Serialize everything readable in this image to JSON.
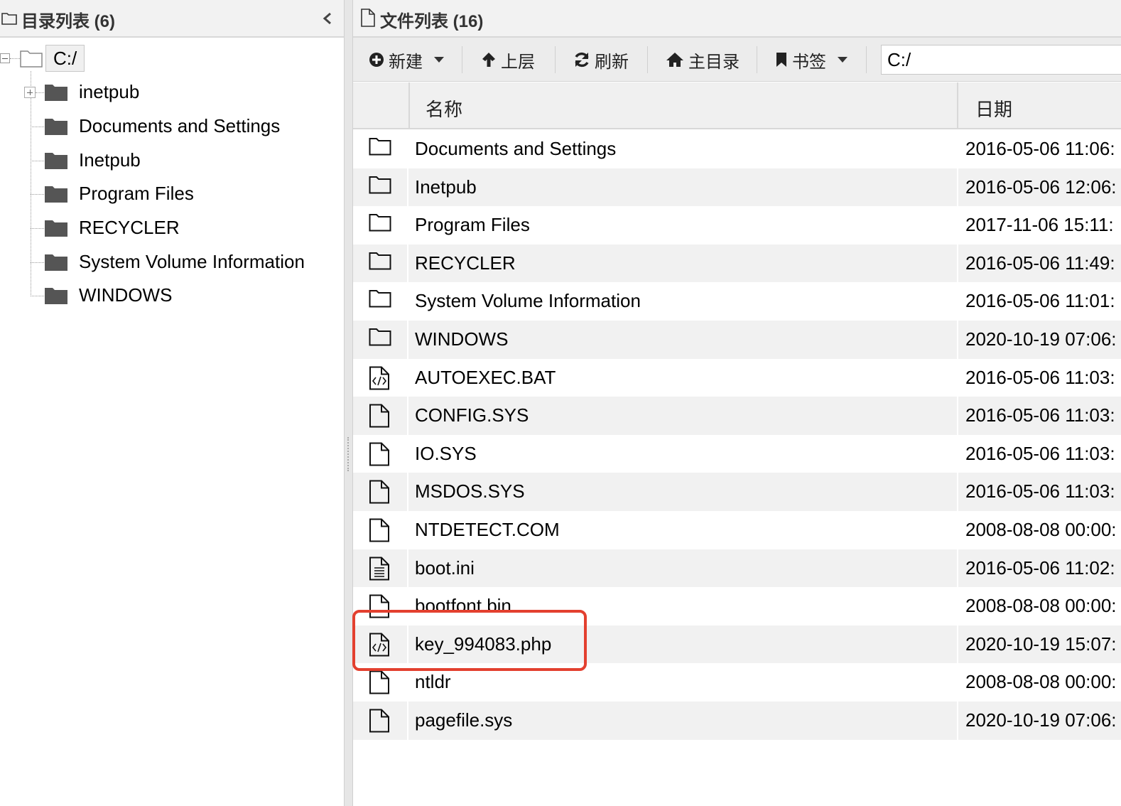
{
  "left_panel": {
    "title": "目录列表 (6)",
    "root": {
      "label": "C:/"
    },
    "items": [
      {
        "label": "inetpub",
        "expandable": true
      },
      {
        "label": "Documents and Settings"
      },
      {
        "label": "Inetpub"
      },
      {
        "label": "Program Files"
      },
      {
        "label": "RECYCLER"
      },
      {
        "label": "System Volume Information"
      },
      {
        "label": "WINDOWS"
      }
    ]
  },
  "right_panel": {
    "title": "文件列表 (16)",
    "toolbar": {
      "new_label": "新建",
      "up_label": "上层",
      "refresh_label": "刷新",
      "home_label": "主目录",
      "bookmark_label": "书签",
      "path_value": "C:/"
    },
    "columns": {
      "name": "名称",
      "date": "日期"
    },
    "files": [
      {
        "name": "Documents and Settings",
        "date": "2016-05-06 11:06:",
        "type": "folder-icon"
      },
      {
        "name": "Inetpub",
        "date": "2016-05-06 12:06:",
        "type": "folder-icon"
      },
      {
        "name": "Program Files",
        "date": "2017-11-06 15:11:",
        "type": "folder-icon"
      },
      {
        "name": "RECYCLER",
        "date": "2016-05-06 11:49:",
        "type": "folder-icon"
      },
      {
        "name": "System Volume Information",
        "date": "2016-05-06 11:01:",
        "type": "folder-icon"
      },
      {
        "name": "WINDOWS",
        "date": "2020-10-19 07:06:",
        "type": "folder-icon"
      },
      {
        "name": "AUTOEXEC.BAT",
        "date": "2016-05-06 11:03:",
        "type": "code-file-icon"
      },
      {
        "name": "CONFIG.SYS",
        "date": "2016-05-06 11:03:",
        "type": "file-icon"
      },
      {
        "name": "IO.SYS",
        "date": "2016-05-06 11:03:",
        "type": "file-icon"
      },
      {
        "name": "MSDOS.SYS",
        "date": "2016-05-06 11:03:",
        "type": "file-icon"
      },
      {
        "name": "NTDETECT.COM",
        "date": "2008-08-08 00:00:",
        "type": "file-icon"
      },
      {
        "name": "boot.ini",
        "date": "2016-05-06 11:02:",
        "type": "text-file-icon"
      },
      {
        "name": "bootfont.bin",
        "date": "2008-08-08 00:00:",
        "type": "file-icon"
      },
      {
        "name": "key_994083.php",
        "date": "2020-10-19 15:07:",
        "type": "code-file-icon"
      },
      {
        "name": "ntldr",
        "date": "2008-08-08 00:00:",
        "type": "file-icon"
      },
      {
        "name": "pagefile.sys",
        "date": "2020-10-19 07:06:",
        "type": "file-icon"
      }
    ]
  },
  "colors": {
    "highlight": "#e3402f",
    "row_alt": "#f1f1f1",
    "header_bg": "#f2f2f2"
  }
}
